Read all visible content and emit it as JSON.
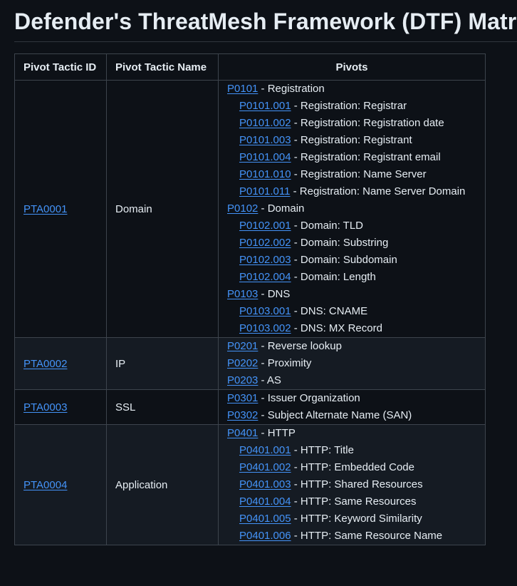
{
  "title": "Defender's ThreatMesh Framework (DTF) Matrix",
  "table": {
    "headers": [
      "Pivot Tactic ID",
      "Pivot Tactic Name",
      "Pivots"
    ],
    "rows": [
      {
        "id": "PTA0001",
        "name": "Domain",
        "pivots": [
          {
            "code": "P0101",
            "desc": " - Registration"
          },
          {
            "code": "P0101.001",
            "desc": " - Registration: Registrar"
          },
          {
            "code": "P0101.002",
            "desc": " - Registration: Registration date"
          },
          {
            "code": "P0101.003",
            "desc": " - Registration: Registrant"
          },
          {
            "code": "P0101.004",
            "desc": " - Registration: Registrant email"
          },
          {
            "code": "P0101.010",
            "desc": " - Registration: Name Server"
          },
          {
            "code": "P0101.011",
            "desc": " - Registration: Name Server Domain"
          },
          {
            "code": "P0102",
            "desc": " - Domain"
          },
          {
            "code": "P0102.001",
            "desc": " - Domain: TLD"
          },
          {
            "code": "P0102.002",
            "desc": " - Domain: Substring"
          },
          {
            "code": "P0102.003",
            "desc": " - Domain: Subdomain"
          },
          {
            "code": "P0102.004",
            "desc": " - Domain: Length"
          },
          {
            "code": "P0103",
            "desc": " - DNS"
          },
          {
            "code": "P0103.001",
            "desc": " - DNS: CNAME"
          },
          {
            "code": "P0103.002",
            "desc": " - DNS: MX Record"
          }
        ]
      },
      {
        "id": "PTA0002",
        "name": "IP",
        "pivots": [
          {
            "code": "P0201",
            "desc": " - Reverse lookup"
          },
          {
            "code": "P0202",
            "desc": " - Proximity"
          },
          {
            "code": "P0203",
            "desc": " - AS"
          }
        ]
      },
      {
        "id": "PTA0003",
        "name": "SSL",
        "pivots": [
          {
            "code": "P0301",
            "desc": " - Issuer Organization"
          },
          {
            "code": "P0302",
            "desc": " - Subject Alternate Name (SAN)"
          }
        ]
      },
      {
        "id": "PTA0004",
        "name": "Application",
        "pivots": [
          {
            "code": "P0401",
            "desc": " - HTTP"
          },
          {
            "code": "P0401.001",
            "desc": " - HTTP: Title"
          },
          {
            "code": "P0401.002",
            "desc": " - HTTP: Embedded Code"
          },
          {
            "code": "P0401.003",
            "desc": " - HTTP: Shared Resources"
          },
          {
            "code": "P0401.004",
            "desc": " - HTTP: Same Resources"
          },
          {
            "code": "P0401.005",
            "desc": " - HTTP: Keyword Similarity"
          },
          {
            "code": "P0401.006",
            "desc": " - HTTP: Same Resource Name"
          }
        ]
      }
    ]
  }
}
